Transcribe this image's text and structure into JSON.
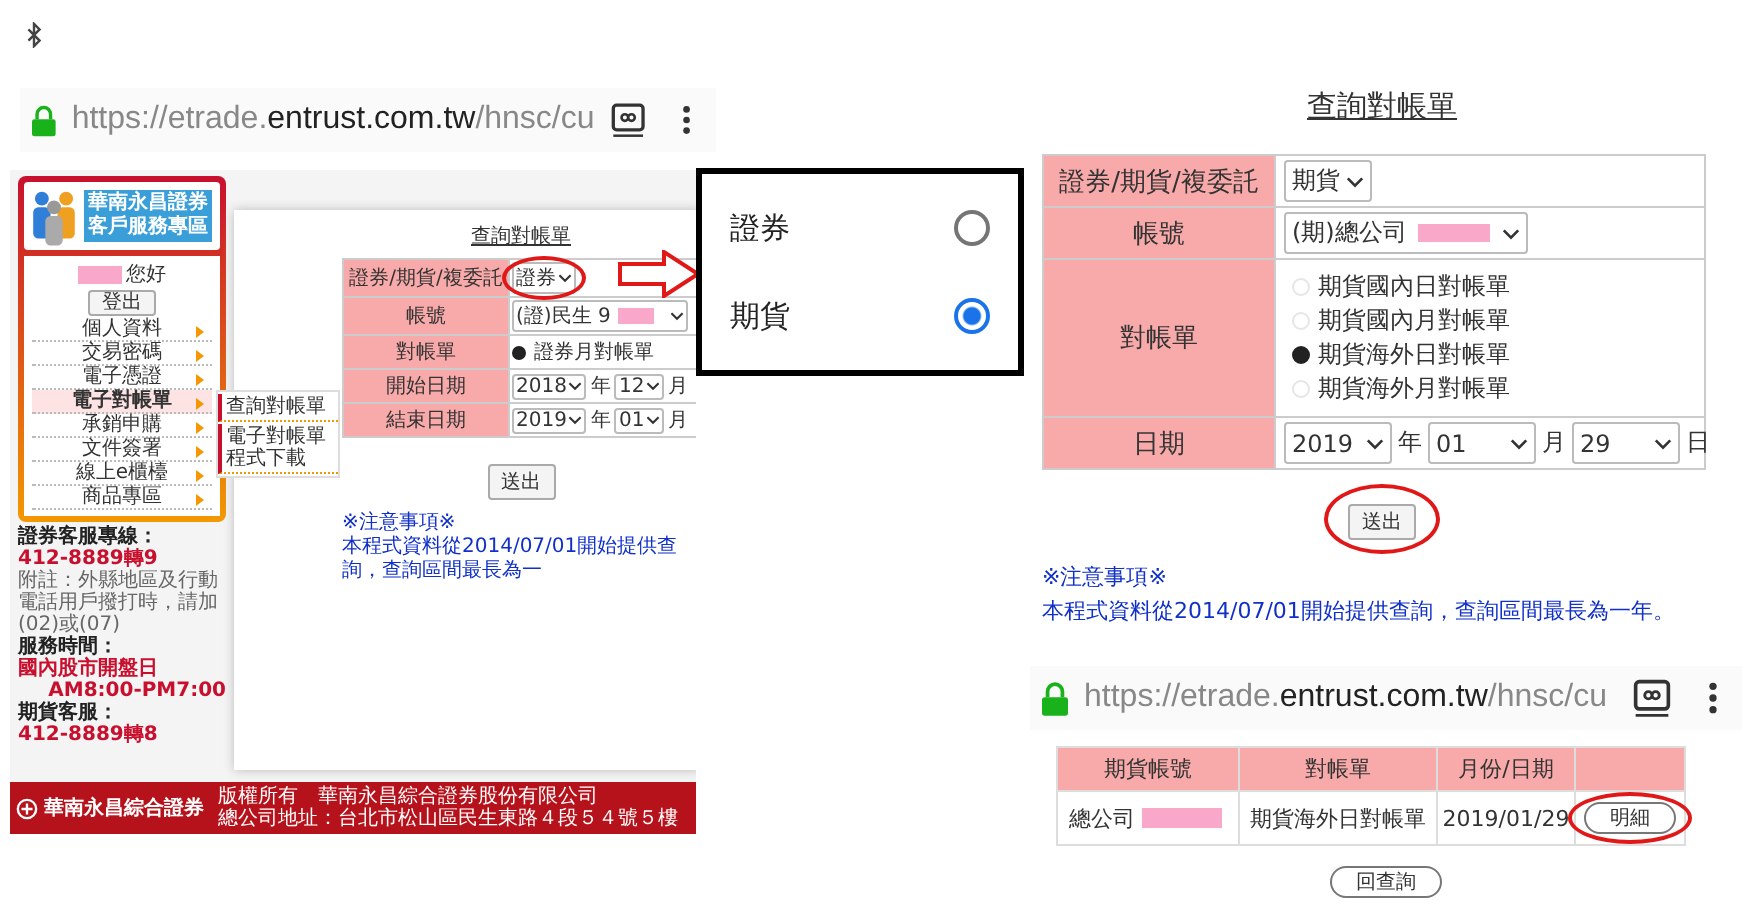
{
  "left_phone": {
    "url": {
      "prefix": "https://etrade.",
      "domain": "entrust.com.tw",
      "suffix": "/hnsc/cu"
    },
    "page": {
      "logo_lines": [
        "華南永昌證券",
        "客戶服務專區"
      ],
      "greeting": "您好",
      "logout": "登出",
      "menu": [
        {
          "label": "個人資料",
          "selected": false
        },
        {
          "label": "交易密碼",
          "selected": false
        },
        {
          "label": "電子憑證",
          "selected": false
        },
        {
          "label": "電子對帳單",
          "selected": true,
          "children": [
            {
              "label": "查詢對帳單"
            },
            {
              "label": "電子對帳單程式下載"
            }
          ]
        },
        {
          "label": "承銷申購",
          "selected": false
        },
        {
          "label": "文件簽署",
          "selected": false
        },
        {
          "label": "線上e櫃檯",
          "selected": false
        },
        {
          "label": "商品專區",
          "selected": false
        }
      ],
      "contacts": {
        "hotline_label": "證券客服專線：",
        "hotline": "412-8889轉9",
        "note": "附註：外縣地區及行動電話用戶撥打時，請加(02)或(07)",
        "hours_label": "服務時間：",
        "hours_days": "國內股市開盤日",
        "hours": "AM8:00-PM7:00",
        "futures_label": "期貨客服：",
        "futures": "412-8889轉8"
      },
      "form": {
        "title": "查詢對帳單",
        "rows": [
          {
            "kind": "select",
            "label": "證券/期貨/複委託",
            "value": "證券",
            "circled": true
          },
          {
            "kind": "account",
            "label": "帳號",
            "value": "(證)民生 9"
          },
          {
            "kind": "radios",
            "label": "對帳單",
            "options": [
              {
                "label": "證券月對帳單",
                "selected": true
              }
            ]
          },
          {
            "kind": "month",
            "label": "開始日期",
            "year": "2018",
            "year_unit": "年",
            "month": "12",
            "month_unit": "月"
          },
          {
            "kind": "month",
            "label": "結束日期",
            "year": "2019",
            "year_unit": "年",
            "month": "01",
            "month_unit": "月"
          }
        ],
        "submit": {
          "label": "送出",
          "circled": false
        },
        "notes_title": "※注意事項※",
        "notes": "本程式資料從2014/07/01開始提供查詢，查詢區間最長為一"
      },
      "footer": {
        "brand": "華南永昌綜合證券",
        "copyright": "版權所有　華南永昌綜合證券股份有限公司",
        "address": "總公司地址：台北市松山區民生東路４段５４號５樓"
      }
    }
  },
  "picker": {
    "options": [
      {
        "label": "證券",
        "selected": false
      },
      {
        "label": "期貨",
        "selected": true
      }
    ]
  },
  "right_form": {
    "title": "查詢對帳單",
    "rows": [
      {
        "kind": "select",
        "label": "證券/期貨/複委託",
        "value": "期貨",
        "circled": false
      },
      {
        "kind": "account",
        "label": "帳號",
        "value": "(期)總公司"
      },
      {
        "kind": "radios",
        "label": "對帳單",
        "options": [
          {
            "label": "期貨國內日對帳單",
            "selected": false
          },
          {
            "label": "期貨國內月對帳單",
            "selected": false
          },
          {
            "label": "期貨海外日對帳單",
            "selected": true
          },
          {
            "label": "期貨海外月對帳單",
            "selected": false
          }
        ]
      },
      {
        "kind": "date",
        "label": "日期",
        "year": "2019",
        "year_unit": "年",
        "month": "01",
        "month_unit": "月",
        "day": "29",
        "day_unit": "日"
      }
    ],
    "submit": {
      "label": "送出",
      "circled": true
    },
    "notes_title": "※注意事項※",
    "notes": "本程式資料從2014/07/01開始提供查詢，查詢區間最長為一年。"
  },
  "result_phone": {
    "url": {
      "prefix": "https://etrade.",
      "domain": "entrust.com.tw",
      "suffix": "/hnsc/cu"
    },
    "table": {
      "columns": [
        "期貨帳號",
        "對帳單",
        "月份/日期"
      ],
      "rows": [
        {
          "account": "總公司",
          "statement": "期貨海外日對帳單",
          "date": "2019/01/29",
          "action": "明細",
          "circled": true
        }
      ]
    },
    "back_button": "回查詢"
  }
}
